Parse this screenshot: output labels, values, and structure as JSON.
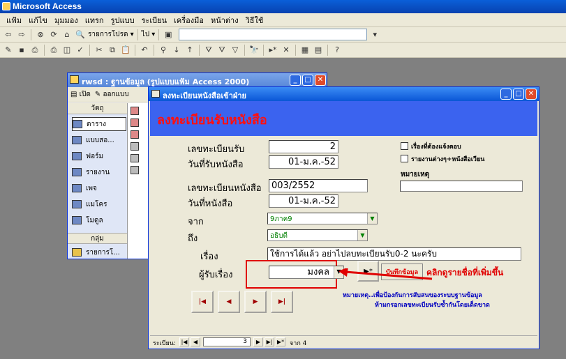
{
  "app": {
    "title": "Microsoft Access"
  },
  "menu": [
    "แฟ้ม",
    "แก้ไข",
    "มุมมอง",
    "แทรก",
    "รูปแบบ",
    "ระเบียน",
    "เครื่องมือ",
    "หน้าต่าง",
    "วิธีใช้"
  ],
  "toolbar": {
    "favorites_label": "รายการโปรด ▾",
    "go_label": "ไป ▾"
  },
  "db_window": {
    "title": "rwsd : ฐานข้อมูล (รูปแบบแฟ้ม Access 2000)",
    "open_label": "เปิด",
    "design_label": "ออกแบบ",
    "objects_header": "วัตถุ",
    "objects": [
      "ตาราง",
      "แบบสอ...",
      "ฟอร์ม",
      "รายงาน",
      "เพจ",
      "แมโคร",
      "โมดูล"
    ],
    "groups_header": "กลุ่ม",
    "groups": [
      "รายการโ..."
    ]
  },
  "form_window": {
    "title": "ลงทะเบียนหนังสือเข้าฝ่าย",
    "header": "ลงทะเบียนรับหนังสือ",
    "fields": {
      "reg_no_label": "เลขทะเบียนรับ",
      "reg_no": "2",
      "recv_date_label": "วันที่รับหนังสือ",
      "recv_date": "01-ม.ค.-52",
      "book_no_label": "เลขทะเบียนหนังสือ",
      "book_no": "003/2552",
      "book_date_label": "วันที่หนังสือ",
      "book_date": "01-ม.ค.-52",
      "from_label": "จาก",
      "from": "9ภาค9",
      "to_label": "ถึง",
      "to": "อธิบดี",
      "subject_label": "เรื่อง",
      "subject": "ใช้การได้แล้ว อย่าไปลบทะเบียนรับ0-2 นะครับ",
      "receiver_label": "ผู้รับเรื่อง",
      "receiver": "มงคล"
    },
    "checkboxes": [
      "เรื่องที่ต้องแจ้งตอบ",
      "รายงานต่างๆ+หนังสือเวียน"
    ],
    "remark_label": "หมายเหตุ",
    "remark_value": "",
    "add_button": "▶*",
    "save_label": "บันทึกข้อมูล",
    "nav_buttons": [
      "|◀",
      "◀",
      "▶",
      "▶|"
    ],
    "annotation": "คลิกดูรายชื่อที่เพิ่มขึ้น",
    "note_line1": "หมายเหตุ..เพื่อป้องกันการสับสนของระบบฐานข้อมูล",
    "note_line2": "ห้ามกรอกเลขทะเบียนรับซ้ำกันโดยเด็ดขาด",
    "record_nav": {
      "label": "ระเบียน:",
      "current": "3",
      "of_label": "จาก 4"
    }
  },
  "colors": {
    "header_blue": "#3b63ef",
    "annotation_red": "#e00000",
    "note_blue": "#0000c0"
  }
}
